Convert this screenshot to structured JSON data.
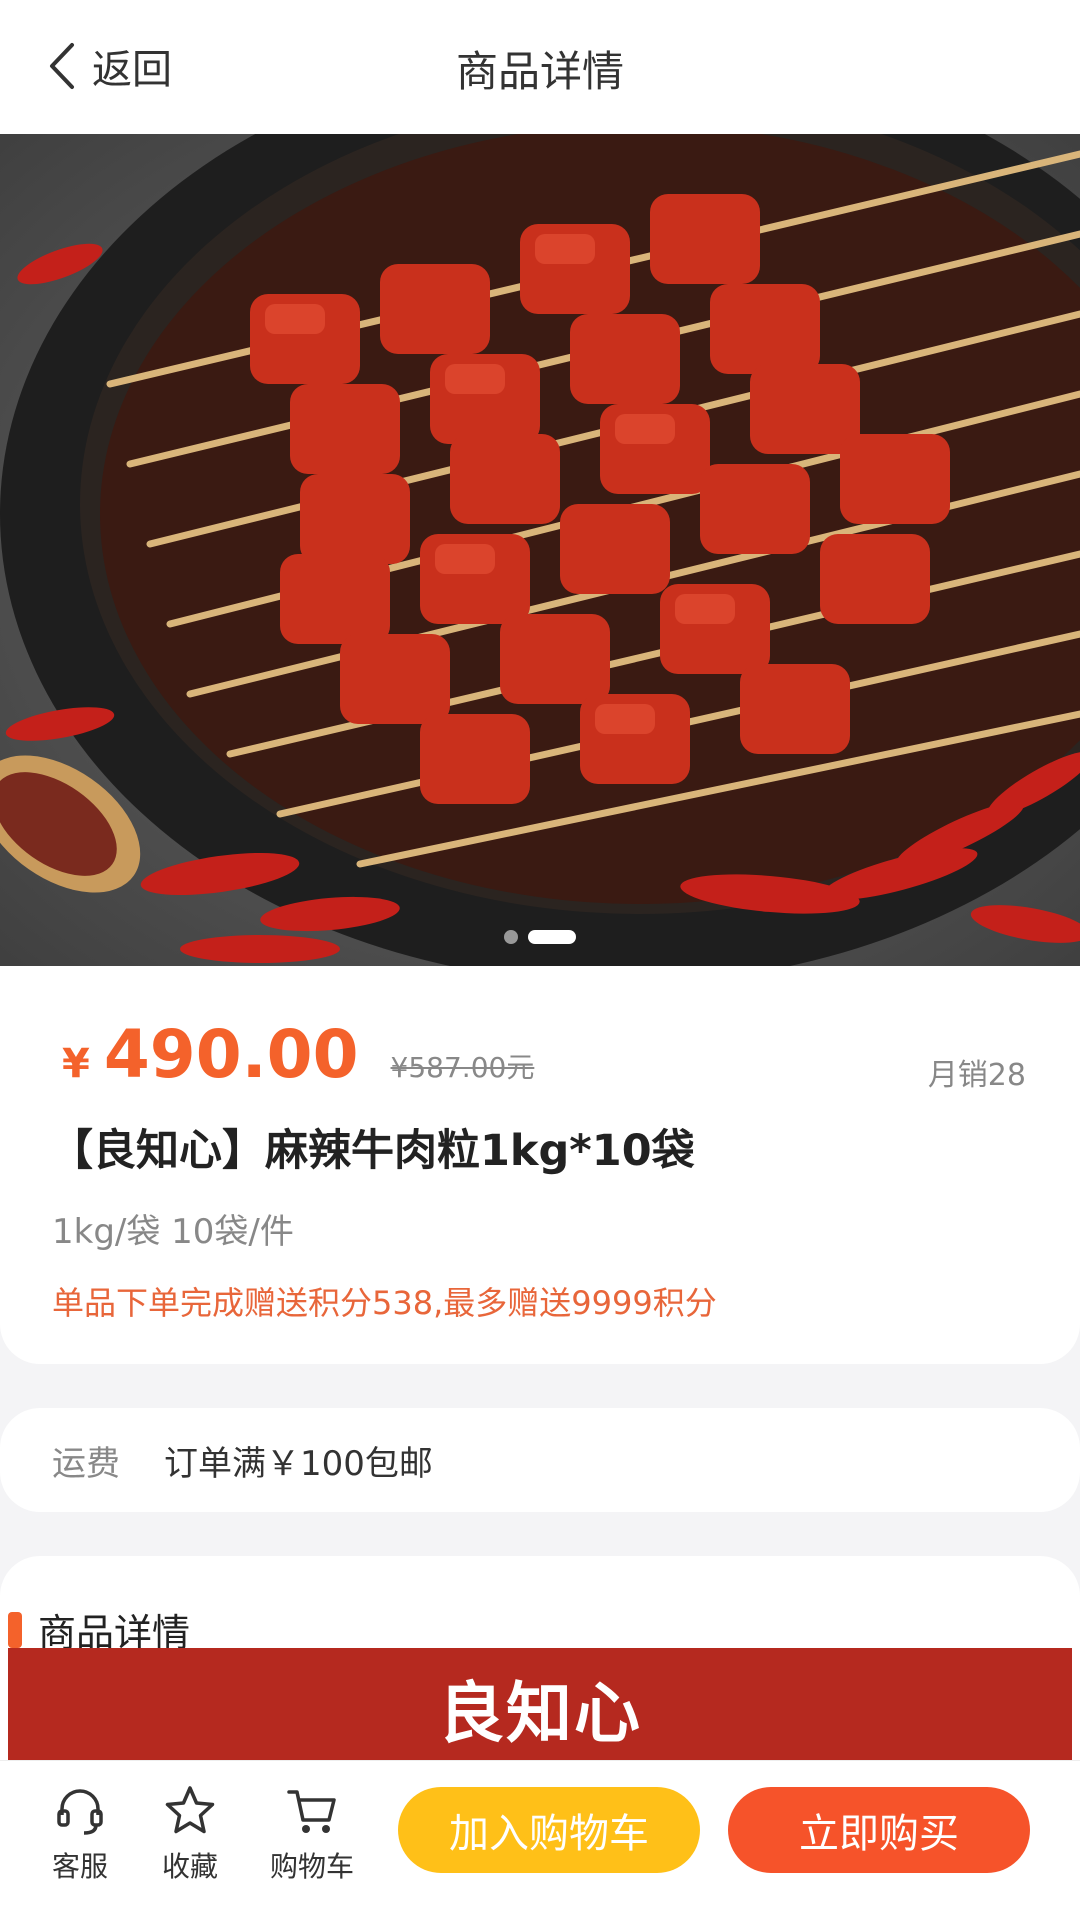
{
  "header": {
    "back_label": "返回",
    "title": "商品详情"
  },
  "hero": {
    "image": "skewered spicy beef cubes in a dark pan with dried chili peppers",
    "slide_index": 2,
    "slide_count": 2
  },
  "product": {
    "currency": "¥",
    "price": "490.00",
    "original_price": "¥587.00元",
    "monthly_sales": "月销28",
    "title": "【良知心】麻辣牛肉粒1kg*10袋",
    "spec": "1kg/袋 10袋/件",
    "promo": "单品下单完成赠送积分538,最多赠送9999积分"
  },
  "shipping": {
    "label": "运费",
    "value": "订单满￥100包邮"
  },
  "detail": {
    "title": "商品详情",
    "banner_brand": "良知心"
  },
  "bottom_bar": {
    "service": {
      "label": "客服",
      "icon": "headset-icon"
    },
    "favorite": {
      "label": "收藏",
      "icon": "star-icon"
    },
    "cart": {
      "label": "购物车",
      "icon": "cart-icon"
    },
    "add_to_cart": "加入购物车",
    "buy_now": "立即购买"
  },
  "colors": {
    "accent": "#f4622b",
    "cart_button": "#ffc018",
    "buy_button": "#f6532a",
    "banner": "#b5291f"
  }
}
